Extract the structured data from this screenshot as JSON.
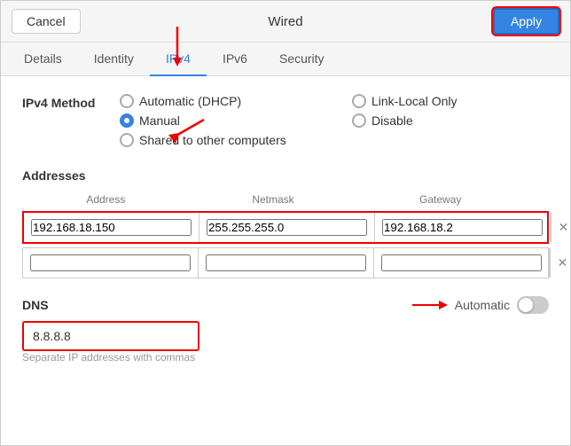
{
  "titlebar": {
    "cancel_label": "Cancel",
    "title": "Wired",
    "apply_label": "Apply"
  },
  "tabs": {
    "items": [
      {
        "label": "Details",
        "active": false
      },
      {
        "label": "Identity",
        "active": false
      },
      {
        "label": "IPv4",
        "active": true
      },
      {
        "label": "IPv6",
        "active": false
      },
      {
        "label": "Security",
        "active": false
      }
    ]
  },
  "ipv4": {
    "method_label": "IPv4 Method",
    "methods": [
      {
        "label": "Automatic (DHCP)",
        "checked": false
      },
      {
        "label": "Link-Local Only",
        "checked": false
      },
      {
        "label": "Manual",
        "checked": true
      },
      {
        "label": "Disable",
        "checked": false
      },
      {
        "label": "Shared to other computers",
        "checked": false
      }
    ],
    "addresses_label": "Addresses",
    "columns": [
      "Address",
      "Netmask",
      "Gateway"
    ],
    "rows": [
      {
        "address": "192.168.18.150",
        "netmask": "255.255.255.0",
        "gateway": "192.168.18.2",
        "hasDelete": true,
        "outlined": true
      },
      {
        "address": "",
        "netmask": "",
        "gateway": "",
        "hasDelete": true,
        "outlined": false
      }
    ],
    "dns_label": "DNS",
    "dns_auto_label": "Automatic",
    "dns_value": "8.8.8.8",
    "dns_hint": "Separate IP addresses with commas"
  }
}
